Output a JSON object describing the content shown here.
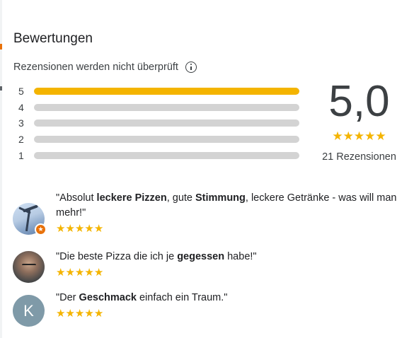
{
  "colors": {
    "star": "#f4b400",
    "bar_track": "#d3d3d3",
    "badge": "#e8710a",
    "avatar_k": "#7f9aa8"
  },
  "header": {
    "title": "Bewertungen",
    "subtitle": "Rezensionen werden nicht überprüft",
    "info_icon": "info-icon"
  },
  "distribution": [
    {
      "label": "5",
      "fraction": 1.0
    },
    {
      "label": "4",
      "fraction": 0
    },
    {
      "label": "3",
      "fraction": 0
    },
    {
      "label": "2",
      "fraction": 0
    },
    {
      "label": "1",
      "fraction": 0
    }
  ],
  "summary": {
    "score": "5,0",
    "stars": 5,
    "count_label": "21 Rezensionen"
  },
  "reviews": [
    {
      "avatar_icon": "profile-photo-palm",
      "badge_icon": "local-guide-star-icon",
      "parts": [
        {
          "t": "\"Absolut ",
          "b": false
        },
        {
          "t": "leckere Pizzen",
          "b": true
        },
        {
          "t": ", gute ",
          "b": false
        },
        {
          "t": "Stimmung",
          "b": true
        },
        {
          "t": ", leckere Getränke - was will man mehr!\"",
          "b": false
        }
      ],
      "stars": 5
    },
    {
      "avatar_icon": "profile-photo-man",
      "parts": [
        {
          "t": "\"Die beste Pizza die ich je ",
          "b": false
        },
        {
          "t": "gegessen",
          "b": true
        },
        {
          "t": " habe!\"",
          "b": false
        }
      ],
      "stars": 5
    },
    {
      "avatar_letter": "K",
      "parts": [
        {
          "t": "\"Der ",
          "b": false
        },
        {
          "t": "Geschmack",
          "b": true
        },
        {
          "t": " einfach ein Traum.\"",
          "b": false
        }
      ],
      "stars": 5
    }
  ]
}
